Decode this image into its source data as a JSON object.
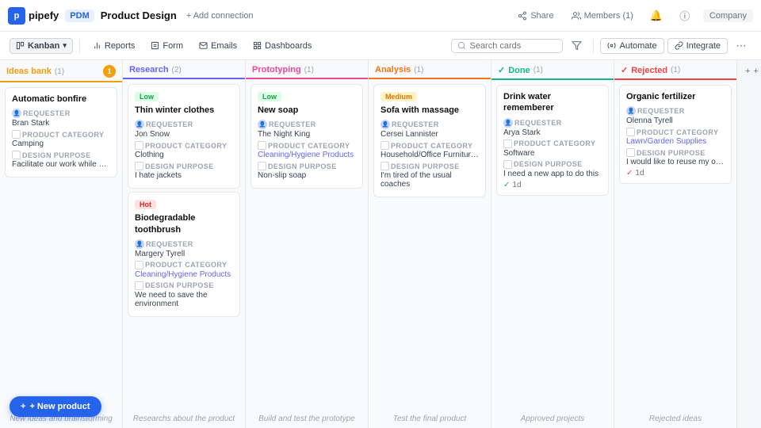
{
  "app": {
    "logo_text": "pipefy",
    "logo_initial": "P",
    "breadcrumb": "PDM",
    "title": "Product Design",
    "add_connection": "+ Add connection",
    "share": "Share",
    "members": "Members (1)",
    "company": "Company"
  },
  "toolbar": {
    "kanban": "Kanban",
    "reports": "Reports",
    "form": "Form",
    "emails": "Emails",
    "dashboards": "Dashboards",
    "search_placeholder": "Search cards",
    "automate": "Automate",
    "integrate": "Integrate"
  },
  "columns": [
    {
      "id": "ideas",
      "label": "Ideas bank",
      "count": 1,
      "theme": "ideas",
      "badge": "1",
      "prefix": "",
      "cards": [
        {
          "title": "Automatic bonfire",
          "badge": null,
          "fields": [
            {
              "label": "REQUESTER",
              "value": "Bran Stark",
              "icon": "avatar"
            },
            {
              "label": "PRODUCT CATEGORY",
              "value": "Camping",
              "icon": "category"
            },
            {
              "label": "DESIGN PURPOSE",
              "value": "Facilitate our work while we are c...",
              "icon": "design"
            }
          ]
        }
      ],
      "footer": "New ideas and brainstorming"
    },
    {
      "id": "research",
      "label": "Research",
      "count": 2,
      "theme": "research",
      "badge": null,
      "prefix": "",
      "cards": [
        {
          "title": "Thin winter clothes",
          "badge": "Low",
          "badge_type": "low",
          "fields": [
            {
              "label": "REQUESTER",
              "value": "Jon Snow",
              "icon": "avatar"
            },
            {
              "label": "PRODUCT CATEGORY",
              "value": "Clothing",
              "icon": "category"
            },
            {
              "label": "DESIGN PURPOSE",
              "value": "I hate jackets",
              "icon": "design"
            }
          ]
        },
        {
          "title": "Biodegradable toothbrush",
          "badge": "Hot",
          "badge_type": "hot",
          "fields": [
            {
              "label": "REQUESTER",
              "value": "Margery Tyrell",
              "icon": "avatar"
            },
            {
              "label": "PRODUCT CATEGORY",
              "value": "Cleaning/Hygiene Products",
              "icon": "category"
            },
            {
              "label": "DESIGN PURPOSE",
              "value": "We need to save the environment",
              "icon": "design"
            }
          ]
        }
      ],
      "footer": "Researchs about the product"
    },
    {
      "id": "prototyping",
      "label": "Prototyping",
      "count": 1,
      "theme": "prototyping",
      "badge": null,
      "prefix": "",
      "cards": [
        {
          "title": "New soap",
          "badge": "Low",
          "badge_type": "low",
          "fields": [
            {
              "label": "REQUESTER",
              "value": "The Night King",
              "icon": "avatar"
            },
            {
              "label": "PRODUCT CATEGORY",
              "value": "Cleaning/Hygiene Products",
              "icon": "category"
            },
            {
              "label": "DESIGN PURPOSE",
              "value": "Non-slip soap",
              "icon": "design"
            }
          ]
        }
      ],
      "footer": "Build and test the prototype"
    },
    {
      "id": "analysis",
      "label": "Analysis",
      "count": 1,
      "theme": "analysis",
      "badge": null,
      "prefix": "",
      "cards": [
        {
          "title": "Sofa with massage",
          "badge": "Medium",
          "badge_type": "medium",
          "fields": [
            {
              "label": "REQUESTER",
              "value": "Cersei Lannister",
              "icon": "avatar"
            },
            {
              "label": "PRODUCT CATEGORY",
              "value": "Household/Office Furniture/Furni...",
              "icon": "category"
            },
            {
              "label": "DESIGN PURPOSE",
              "value": "I'm tired of the usual coaches",
              "icon": "design"
            }
          ]
        }
      ],
      "footer": "Test the final product"
    },
    {
      "id": "done",
      "label": "Done",
      "count": 1,
      "theme": "done",
      "badge": null,
      "prefix": "✓",
      "cards": [
        {
          "title": "Drink water rememberer",
          "badge": null,
          "fields": [
            {
              "label": "REQUESTER",
              "value": "Arya Stark",
              "icon": "avatar"
            },
            {
              "label": "PRODUCT CATEGORY",
              "value": "Software",
              "icon": "category"
            },
            {
              "label": "DESIGN PURPOSE",
              "value": "I need a new app to do this",
              "icon": "design"
            },
            {
              "label": "",
              "value": "1d",
              "icon": "check"
            }
          ]
        }
      ],
      "footer": "Approved projects"
    },
    {
      "id": "rejected",
      "label": "Rejected",
      "count": 1,
      "theme": "rejected",
      "badge": null,
      "prefix": "✓",
      "cards": [
        {
          "title": "Organic fertilizer",
          "badge": null,
          "fields": [
            {
              "label": "REQUESTER",
              "value": "Olenna Tyrell",
              "icon": "avatar"
            },
            {
              "label": "PRODUCT CATEGORY",
              "value": "Lawn/Garden Supplies",
              "icon": "category"
            },
            {
              "label": "DESIGN PURPOSE",
              "value": "I would like to reuse my organic tr...",
              "icon": "design"
            },
            {
              "label": "",
              "value": "1d",
              "icon": "check-red"
            }
          ]
        }
      ],
      "footer": "Rejected ideas"
    }
  ],
  "add_phase": "+ New phase",
  "new_product": "+ New product"
}
